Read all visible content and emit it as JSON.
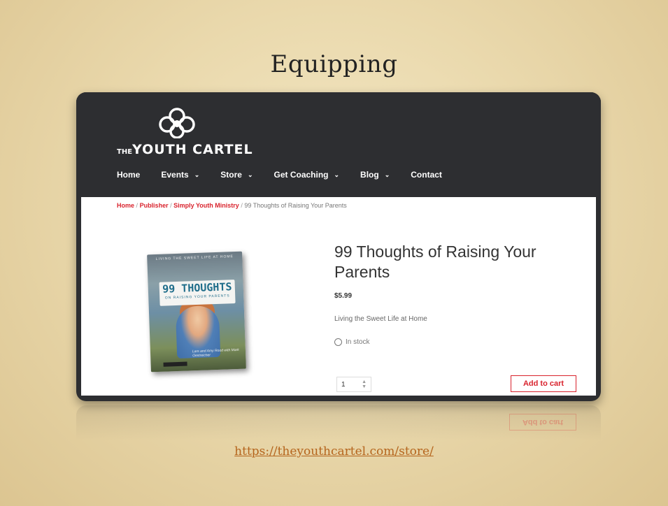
{
  "slide": {
    "title": "Equipping",
    "link": "https://theyouthcartel.com/store/"
  },
  "site": {
    "logo_small": "THE",
    "logo_main": "YOUTH CARTEL",
    "nav": [
      {
        "label": "Home",
        "has_dropdown": false
      },
      {
        "label": "Events",
        "has_dropdown": true
      },
      {
        "label": "Store",
        "has_dropdown": true
      },
      {
        "label": "Get Coaching",
        "has_dropdown": true
      },
      {
        "label": "Blog",
        "has_dropdown": true
      },
      {
        "label": "Contact",
        "has_dropdown": false
      }
    ],
    "breadcrumb": {
      "home": "Home",
      "publisher": "Publisher",
      "simply": "Simply Youth Ministry",
      "current": "99 Thoughts of Raising Your Parents",
      "separator": "/"
    }
  },
  "product": {
    "title": "99 Thoughts of Raising Your Parents",
    "price": "$5.99",
    "tagline": "Living the Sweet Life at Home",
    "stock": "In stock",
    "quantity": "1",
    "add_to_cart": "Add to cart",
    "cover": {
      "top_text": "LIVING THE SWEET LIFE AT HOME",
      "sign_big": "99 THOUGHTS",
      "sign_small": "ON RAISING YOUR PARENTS",
      "authors": "Lars and Amy Rood with Mark Oestreicher"
    }
  },
  "colors": {
    "accent": "#d9232d",
    "header_bg": "#2d2e31",
    "link": "#b5651d"
  }
}
